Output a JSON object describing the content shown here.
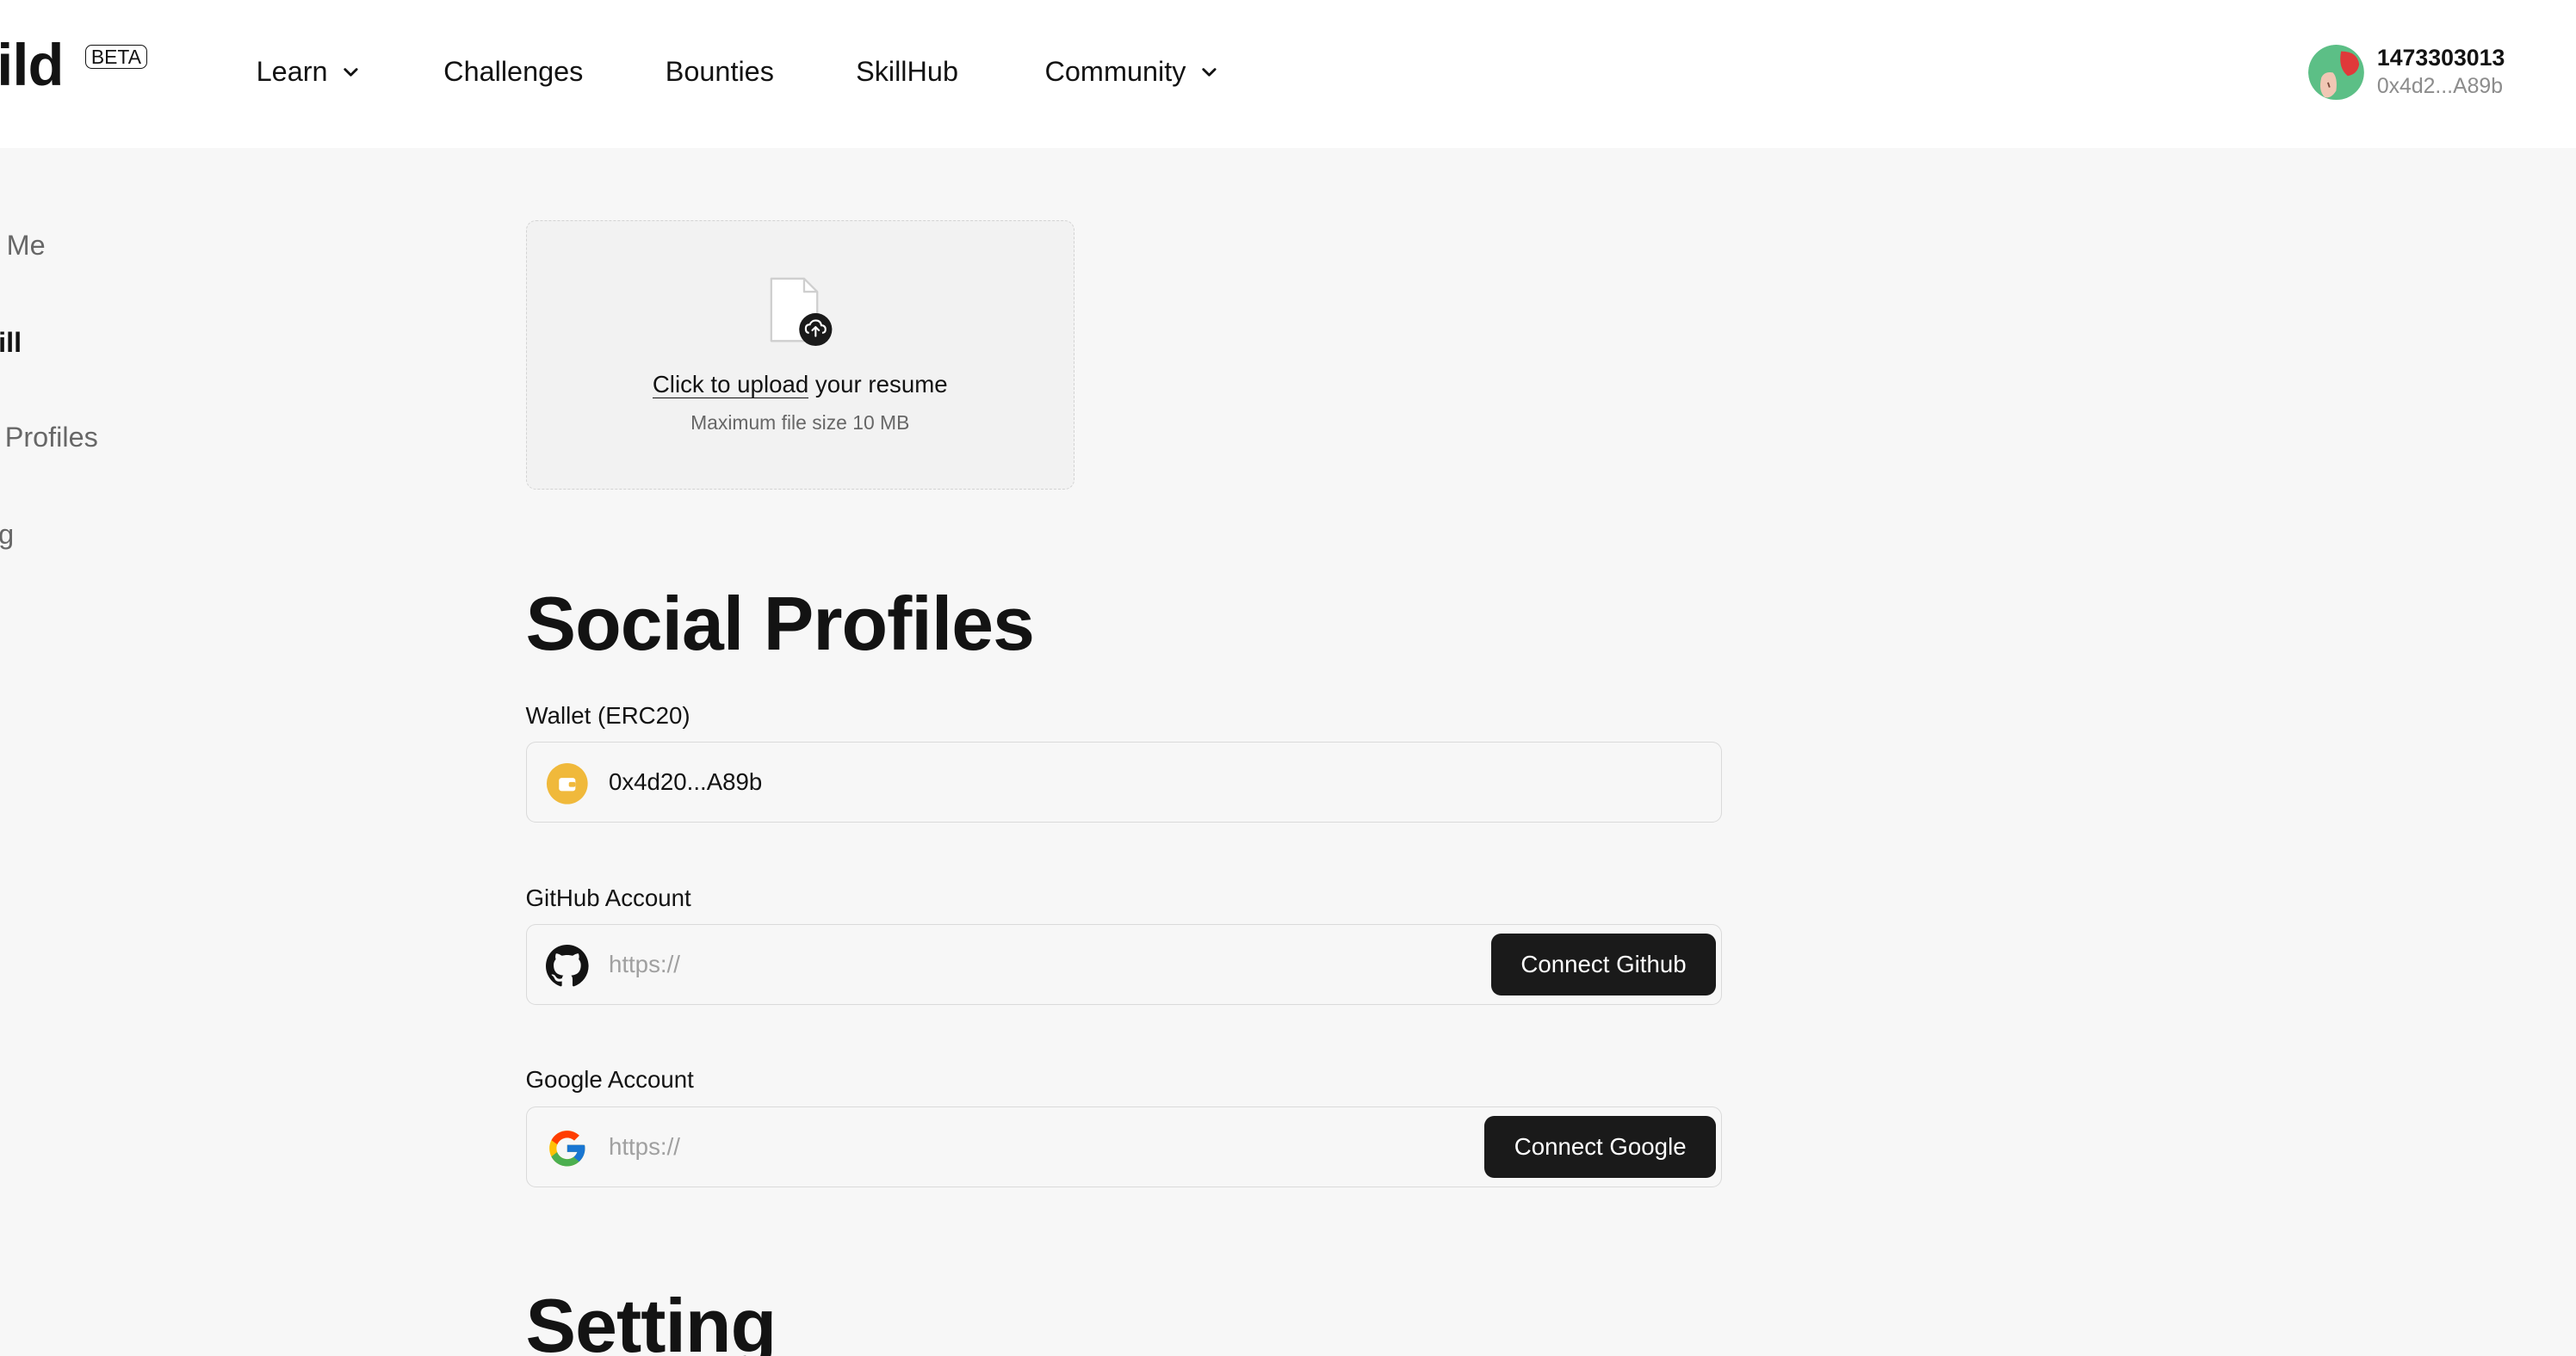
{
  "header": {
    "logo_text": "ild",
    "beta_label": "BETA",
    "nav": {
      "learn": "Learn",
      "challenges": "Challenges",
      "bounties": "Bounties",
      "skillhub": "SkillHub",
      "community": "Community"
    },
    "user": {
      "name": "1473303013",
      "address": "0x4d2...A89b"
    }
  },
  "sidebar": {
    "items": [
      {
        "label": "Me",
        "active": false
      },
      {
        "label": "ill",
        "active": true
      },
      {
        "label": "Profiles",
        "active": false
      },
      {
        "label": "g",
        "active": false
      }
    ]
  },
  "upload": {
    "link_text": "Click to upload",
    "rest_text": " your resume",
    "hint": "Maximum file size 10 MB"
  },
  "social": {
    "title": "Social Profiles",
    "wallet": {
      "label": "Wallet (ERC20)",
      "value": "0x4d20...A89b"
    },
    "github": {
      "label": "GitHub Account",
      "placeholder": "https://",
      "button": "Connect Github"
    },
    "google": {
      "label": "Google Account",
      "placeholder": "https://",
      "button": "Connect Google"
    }
  },
  "setting": {
    "title": "Setting"
  },
  "colors": {
    "page_bg": "#f7f7f7",
    "header_bg": "#ffffff",
    "button_bg": "#1a1a1a",
    "wallet_icon": "#f0b93b"
  }
}
